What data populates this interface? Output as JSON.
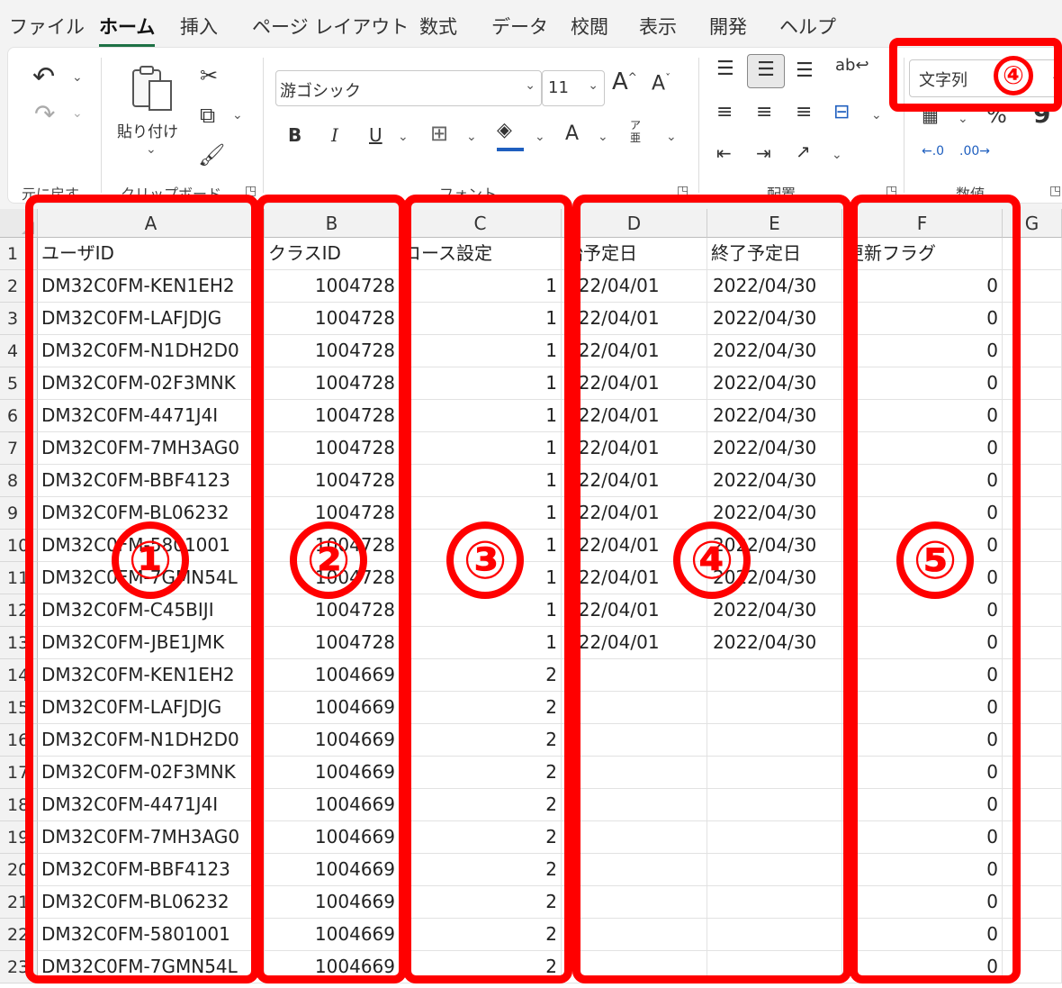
{
  "menu_tabs": [
    "ファイル",
    "ホーム",
    "挿入",
    "ページ レイアウト",
    "数式",
    "データ",
    "校閲",
    "表示",
    "開発",
    "ヘルプ"
  ],
  "ribbon": {
    "clipboard": {
      "paste_label": "貼り付け",
      "group_label": "クリップボード",
      "undo_group_label": "元に戻す"
    },
    "font": {
      "font_name": "游ゴシック",
      "font_size": "11",
      "group_label": "フォント",
      "bold": "B",
      "italic": "I",
      "underline": "U",
      "font_color_glyph": "A",
      "phonetic_glyph": "ア亜"
    },
    "alignment": {
      "group_label": "配置"
    },
    "number": {
      "format_value": "文字列",
      "group_label": "数値",
      "percent": "%",
      "comma": "9"
    }
  },
  "sheet": {
    "column_headers": [
      "A",
      "B",
      "C",
      "D",
      "E",
      "F",
      "G"
    ],
    "header_row": {
      "row_num": "1",
      "a": "ユーザID",
      "b": "クラスID",
      "c": "コース設定",
      "d": "始予定日",
      "e": "終了予定日",
      "f": "更新フラグ"
    },
    "rows": [
      {
        "n": "2",
        "a": "DM32C0FM-KEN1EH2",
        "b": "1004728",
        "c": "1",
        "d": "022/04/01",
        "e": "2022/04/30",
        "f": "0"
      },
      {
        "n": "3",
        "a": "DM32C0FM-LAFJDJG",
        "b": "1004728",
        "c": "1",
        "d": "022/04/01",
        "e": "2022/04/30",
        "f": "0"
      },
      {
        "n": "4",
        "a": "DM32C0FM-N1DH2D0",
        "b": "1004728",
        "c": "1",
        "d": "022/04/01",
        "e": "2022/04/30",
        "f": "0"
      },
      {
        "n": "5",
        "a": "DM32C0FM-02F3MNK",
        "b": "1004728",
        "c": "1",
        "d": "022/04/01",
        "e": "2022/04/30",
        "f": "0"
      },
      {
        "n": "6",
        "a": "DM32C0FM-4471J4I",
        "b": "1004728",
        "c": "1",
        "d": "022/04/01",
        "e": "2022/04/30",
        "f": "0"
      },
      {
        "n": "7",
        "a": "DM32C0FM-7MH3AG0",
        "b": "1004728",
        "c": "1",
        "d": "022/04/01",
        "e": "2022/04/30",
        "f": "0"
      },
      {
        "n": "8",
        "a": "DM32C0FM-BBF4123",
        "b": "1004728",
        "c": "1",
        "d": "022/04/01",
        "e": "2022/04/30",
        "f": "0"
      },
      {
        "n": "9",
        "a": "DM32C0FM-BL06232",
        "b": "1004728",
        "c": "1",
        "d": "022/04/01",
        "e": "2022/04/30",
        "f": "0"
      },
      {
        "n": "10",
        "a": "DM32C0FM-5801001",
        "b": "1004728",
        "c": "1",
        "d": "022/04/01",
        "e": "2022/04/30",
        "f": "0"
      },
      {
        "n": "11",
        "a": "DM32C0FM-7GMN54L",
        "b": "1004728",
        "c": "1",
        "d": "022/04/01",
        "e": "2022/04/30",
        "f": "0"
      },
      {
        "n": "12",
        "a": "DM32C0FM-C45BIJI",
        "b": "1004728",
        "c": "1",
        "d": "022/04/01",
        "e": "2022/04/30",
        "f": "0"
      },
      {
        "n": "13",
        "a": "DM32C0FM-JBE1JMK",
        "b": "1004728",
        "c": "1",
        "d": "022/04/01",
        "e": "2022/04/30",
        "f": "0"
      },
      {
        "n": "14",
        "a": "DM32C0FM-KEN1EH2",
        "b": "1004669",
        "c": "2",
        "d": "",
        "e": "",
        "f": "0"
      },
      {
        "n": "15",
        "a": "DM32C0FM-LAFJDJG",
        "b": "1004669",
        "c": "2",
        "d": "",
        "e": "",
        "f": "0"
      },
      {
        "n": "16",
        "a": "DM32C0FM-N1DH2D0",
        "b": "1004669",
        "c": "2",
        "d": "",
        "e": "",
        "f": "0"
      },
      {
        "n": "17",
        "a": "DM32C0FM-02F3MNK",
        "b": "1004669",
        "c": "2",
        "d": "",
        "e": "",
        "f": "0"
      },
      {
        "n": "18",
        "a": "DM32C0FM-4471J4I",
        "b": "1004669",
        "c": "2",
        "d": "",
        "e": "",
        "f": "0"
      },
      {
        "n": "19",
        "a": "DM32C0FM-7MH3AG0",
        "b": "1004669",
        "c": "2",
        "d": "",
        "e": "",
        "f": "0"
      },
      {
        "n": "20",
        "a": "DM32C0FM-BBF4123",
        "b": "1004669",
        "c": "2",
        "d": "",
        "e": "",
        "f": "0"
      },
      {
        "n": "21",
        "a": "DM32C0FM-BL06232",
        "b": "1004669",
        "c": "2",
        "d": "",
        "e": "",
        "f": "0"
      },
      {
        "n": "22",
        "a": "DM32C0FM-5801001",
        "b": "1004669",
        "c": "2",
        "d": "",
        "e": "",
        "f": "0"
      },
      {
        "n": "23",
        "a": "DM32C0FM-7GMN54L",
        "b": "1004669",
        "c": "2",
        "d": "",
        "e": "",
        "f": "0"
      }
    ]
  },
  "annotations": {
    "col_a": "①",
    "col_b": "②",
    "col_c": "③",
    "col_de": "④",
    "col_f": "⑤",
    "number_format": "④"
  },
  "colors": {
    "highlight": "#ff0000",
    "active_tab_underline": "#1e7145",
    "font_color_bar": "#1f5fbf"
  }
}
